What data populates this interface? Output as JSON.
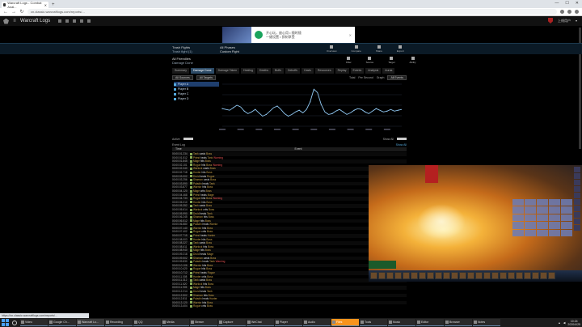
{
  "browser": {
    "tabs": [
      {
        "title": "Warcraft Logs - Combat Anal..."
      }
    ],
    "new_tab": "+",
    "url": "cn.classic.warcraftlogs.com/reports/...",
    "window_controls": [
      "—",
      "☐",
      "✕"
    ]
  },
  "site": {
    "title": "Warcraft Logs",
    "user": "上线用户"
  },
  "ad": {
    "text_line1": "开心玩，放心用 • 随时随",
    "text_line2": "一键设置 • 即刻享受",
    "close": "✕"
  },
  "report": {
    "fight_label": "Trash Fights",
    "fight_sub": "Trash fight (1)",
    "phase_label": "All Phases",
    "phase_sub": "Custom Fight",
    "tools": [
      "Overview",
      "Compare",
      "Share",
      "Export"
    ],
    "actor_name": "All Friendlies",
    "actor_sub": "Damage Done",
    "actor_tools": [
      "Filter",
      "Source",
      "Target",
      "Ability"
    ]
  },
  "view_tabs": [
    "Summary",
    "Damage Done",
    "Damage Taken",
    "Healing",
    "Deaths",
    "Buffs",
    "Debuffs",
    "Casts",
    "Resources",
    "Replay",
    "Events",
    "Analysis",
    "Auras"
  ],
  "active_tab_index": 1,
  "controls": {
    "left": [
      "All Sources",
      "All Targets"
    ],
    "right": [
      "Total",
      "Per Second",
      "Graph",
      "All Events"
    ]
  },
  "legend": [
    {
      "name": "Player A",
      "value": ""
    },
    {
      "name": "Player B",
      "value": ""
    },
    {
      "name": "Player C",
      "value": ""
    },
    {
      "name": "Player D",
      "value": ""
    }
  ],
  "statline": {
    "left": "Active",
    "right": "Show All"
  },
  "log": {
    "title": "Event Log",
    "link": "Show All",
    "col_time": "Time",
    "col_event": "Event",
    "rows": [
      {
        "t": "00:00:01.234",
        "who": "Tank",
        "what": "casts",
        "target": "Boss",
        "tag": ""
      },
      {
        "t": "00:00:01.512",
        "who": "Priest",
        "what": "heals",
        "target": "Tank",
        "tag": "Warning"
      },
      {
        "t": "00:00:01.845",
        "who": "Mage",
        "what": "hits",
        "target": "Boss",
        "tag": ""
      },
      {
        "t": "00:00:02.101",
        "who": "Rogue",
        "what": "hits",
        "target": "Boss",
        "tag": "Warning"
      },
      {
        "t": "00:00:02.340",
        "who": "Warlock",
        "what": "casts",
        "target": "Boss",
        "tag": ""
      },
      {
        "t": "00:00:02.718",
        "who": "Hunter",
        "what": "hits",
        "target": "Boss",
        "tag": ""
      },
      {
        "t": "00:00:03.002",
        "who": "Druid",
        "what": "heals",
        "target": "Rogue",
        "tag": ""
      },
      {
        "t": "00:00:03.256",
        "who": "Shaman",
        "what": "casts",
        "target": "Boss",
        "tag": ""
      },
      {
        "t": "00:00:03.590",
        "who": "Paladin",
        "what": "heals",
        "target": "Tank",
        "tag": ""
      },
      {
        "t": "00:00:03.877",
        "who": "Warrior",
        "what": "hits",
        "target": "Boss",
        "tag": ""
      },
      {
        "t": "00:00:04.120",
        "who": "Mage",
        "what": "crits",
        "target": "Boss",
        "tag": ""
      },
      {
        "t": "00:00:04.468",
        "who": "Priest",
        "what": "heals",
        "target": "Mage",
        "tag": ""
      },
      {
        "t": "00:00:04.733",
        "who": "Rogue",
        "what": "hits",
        "target": "Boss",
        "tag": "Warning"
      },
      {
        "t": "00:00:05.010",
        "who": "Hunter",
        "what": "hits",
        "target": "Boss",
        "tag": ""
      },
      {
        "t": "00:00:05.352",
        "who": "Tank",
        "what": "casts",
        "target": "Boss",
        "tag": ""
      },
      {
        "t": "00:00:05.614",
        "who": "Warlock",
        "what": "crits",
        "target": "Boss",
        "tag": ""
      },
      {
        "t": "00:00:05.990",
        "who": "Druid",
        "what": "heals",
        "target": "Tank",
        "tag": ""
      },
      {
        "t": "00:00:06.245",
        "who": "Shaman",
        "what": "hits",
        "target": "Boss",
        "tag": ""
      },
      {
        "t": "00:00:06.512",
        "who": "Mage",
        "what": "hits",
        "target": "Boss",
        "tag": ""
      },
      {
        "t": "00:00:06.880",
        "who": "Paladin",
        "what": "heals",
        "target": "Warrior",
        "tag": ""
      },
      {
        "t": "00:00:07.140",
        "who": "Warrior",
        "what": "hits",
        "target": "Boss",
        "tag": ""
      },
      {
        "t": "00:00:07.402",
        "who": "Rogue",
        "what": "crits",
        "target": "Boss",
        "tag": ""
      },
      {
        "t": "00:00:07.715",
        "who": "Priest",
        "what": "heals",
        "target": "Hunter",
        "tag": ""
      },
      {
        "t": "00:00:08.003",
        "who": "Hunter",
        "what": "hits",
        "target": "Boss",
        "tag": ""
      },
      {
        "t": "00:00:08.327",
        "who": "Tank",
        "what": "casts",
        "target": "Boss",
        "tag": ""
      },
      {
        "t": "00:00:08.611",
        "who": "Warlock",
        "what": "hits",
        "target": "Boss",
        "tag": ""
      },
      {
        "t": "00:00:08.940",
        "who": "Mage",
        "what": "hits",
        "target": "Boss",
        "tag": ""
      },
      {
        "t": "00:00:09.218",
        "who": "Druid",
        "what": "heals",
        "target": "Mage",
        "tag": ""
      },
      {
        "t": "00:00:09.502",
        "who": "Shaman",
        "what": "casts",
        "target": "Boss",
        "tag": ""
      },
      {
        "t": "00:00:09.830",
        "who": "Paladin",
        "what": "heals",
        "target": "Tank",
        "tag": "Warning"
      },
      {
        "t": "00:00:10.106",
        "who": "Warrior",
        "what": "hits",
        "target": "Boss",
        "tag": ""
      },
      {
        "t": "00:00:10.420",
        "who": "Rogue",
        "what": "hits",
        "target": "Boss",
        "tag": ""
      },
      {
        "t": "00:00:10.712",
        "who": "Priest",
        "what": "heals",
        "target": "Rogue",
        "tag": ""
      },
      {
        "t": "00:00:11.008",
        "who": "Hunter",
        "what": "crits",
        "target": "Boss",
        "tag": ""
      },
      {
        "t": "00:00:11.312",
        "who": "Tank",
        "what": "casts",
        "target": "Boss",
        "tag": ""
      },
      {
        "t": "00:00:11.620",
        "who": "Warlock",
        "what": "hits",
        "target": "Boss",
        "tag": ""
      },
      {
        "t": "00:00:11.905",
        "who": "Mage",
        "what": "hits",
        "target": "Boss",
        "tag": ""
      },
      {
        "t": "00:00:12.214",
        "who": "Druid",
        "what": "heals",
        "target": "Tank",
        "tag": ""
      },
      {
        "t": "00:00:12.502",
        "who": "Shaman",
        "what": "hits",
        "target": "Boss",
        "tag": ""
      },
      {
        "t": "00:00:12.811",
        "who": "Paladin",
        "what": "heals",
        "target": "Hunter",
        "tag": ""
      },
      {
        "t": "00:00:13.120",
        "who": "Warrior",
        "what": "hits",
        "target": "Boss",
        "tag": ""
      },
      {
        "t": "00:00:13.404",
        "who": "Rogue",
        "what": "crits",
        "target": "Boss",
        "tag": ""
      }
    ]
  },
  "chart_data": {
    "type": "line",
    "x": [
      0,
      1,
      2,
      3,
      4,
      5,
      6,
      7,
      8,
      9,
      10,
      11,
      12,
      13,
      14,
      15,
      16,
      17,
      18,
      19,
      20,
      21,
      22,
      23,
      24,
      25,
      26,
      27,
      28,
      29,
      30,
      31,
      32,
      33,
      34,
      35,
      36,
      37,
      38,
      39,
      40,
      41,
      42,
      43,
      44,
      45,
      46,
      47,
      48,
      49
    ],
    "series": [
      {
        "name": "",
        "values": [
          42,
          40,
          38,
          44,
          50,
          46,
          36,
          30,
          34,
          40,
          32,
          24,
          28,
          36,
          44,
          48,
          40,
          30,
          24,
          28,
          34,
          38,
          32,
          40,
          58,
          88,
          80,
          52,
          34,
          28,
          30,
          36,
          40,
          34,
          28,
          32,
          38,
          42,
          40,
          34,
          30,
          36,
          42,
          38,
          34,
          36,
          40,
          36,
          38,
          40
        ]
      }
    ],
    "xlabel": "",
    "ylabel": "",
    "ylim": [
      0,
      100
    ],
    "grid": true,
    "color": "#8fc6f0"
  },
  "taskbar": {
    "items": [
      "Video",
      "Google Ch...",
      "Warcraft Lo...",
      "Recording",
      "QQ",
      "Media",
      "Stream",
      "Capture",
      "WeChat",
      "Player",
      "Audio",
      "Files",
      "Tools",
      "Music",
      "Editor",
      "Browser",
      "Notes"
    ],
    "active_index": 2,
    "orange_index": 11,
    "time": "10:24",
    "date": "2020/4/25"
  },
  "status_url": "https://cn.classic.warcraftlogs.com/reports/..."
}
